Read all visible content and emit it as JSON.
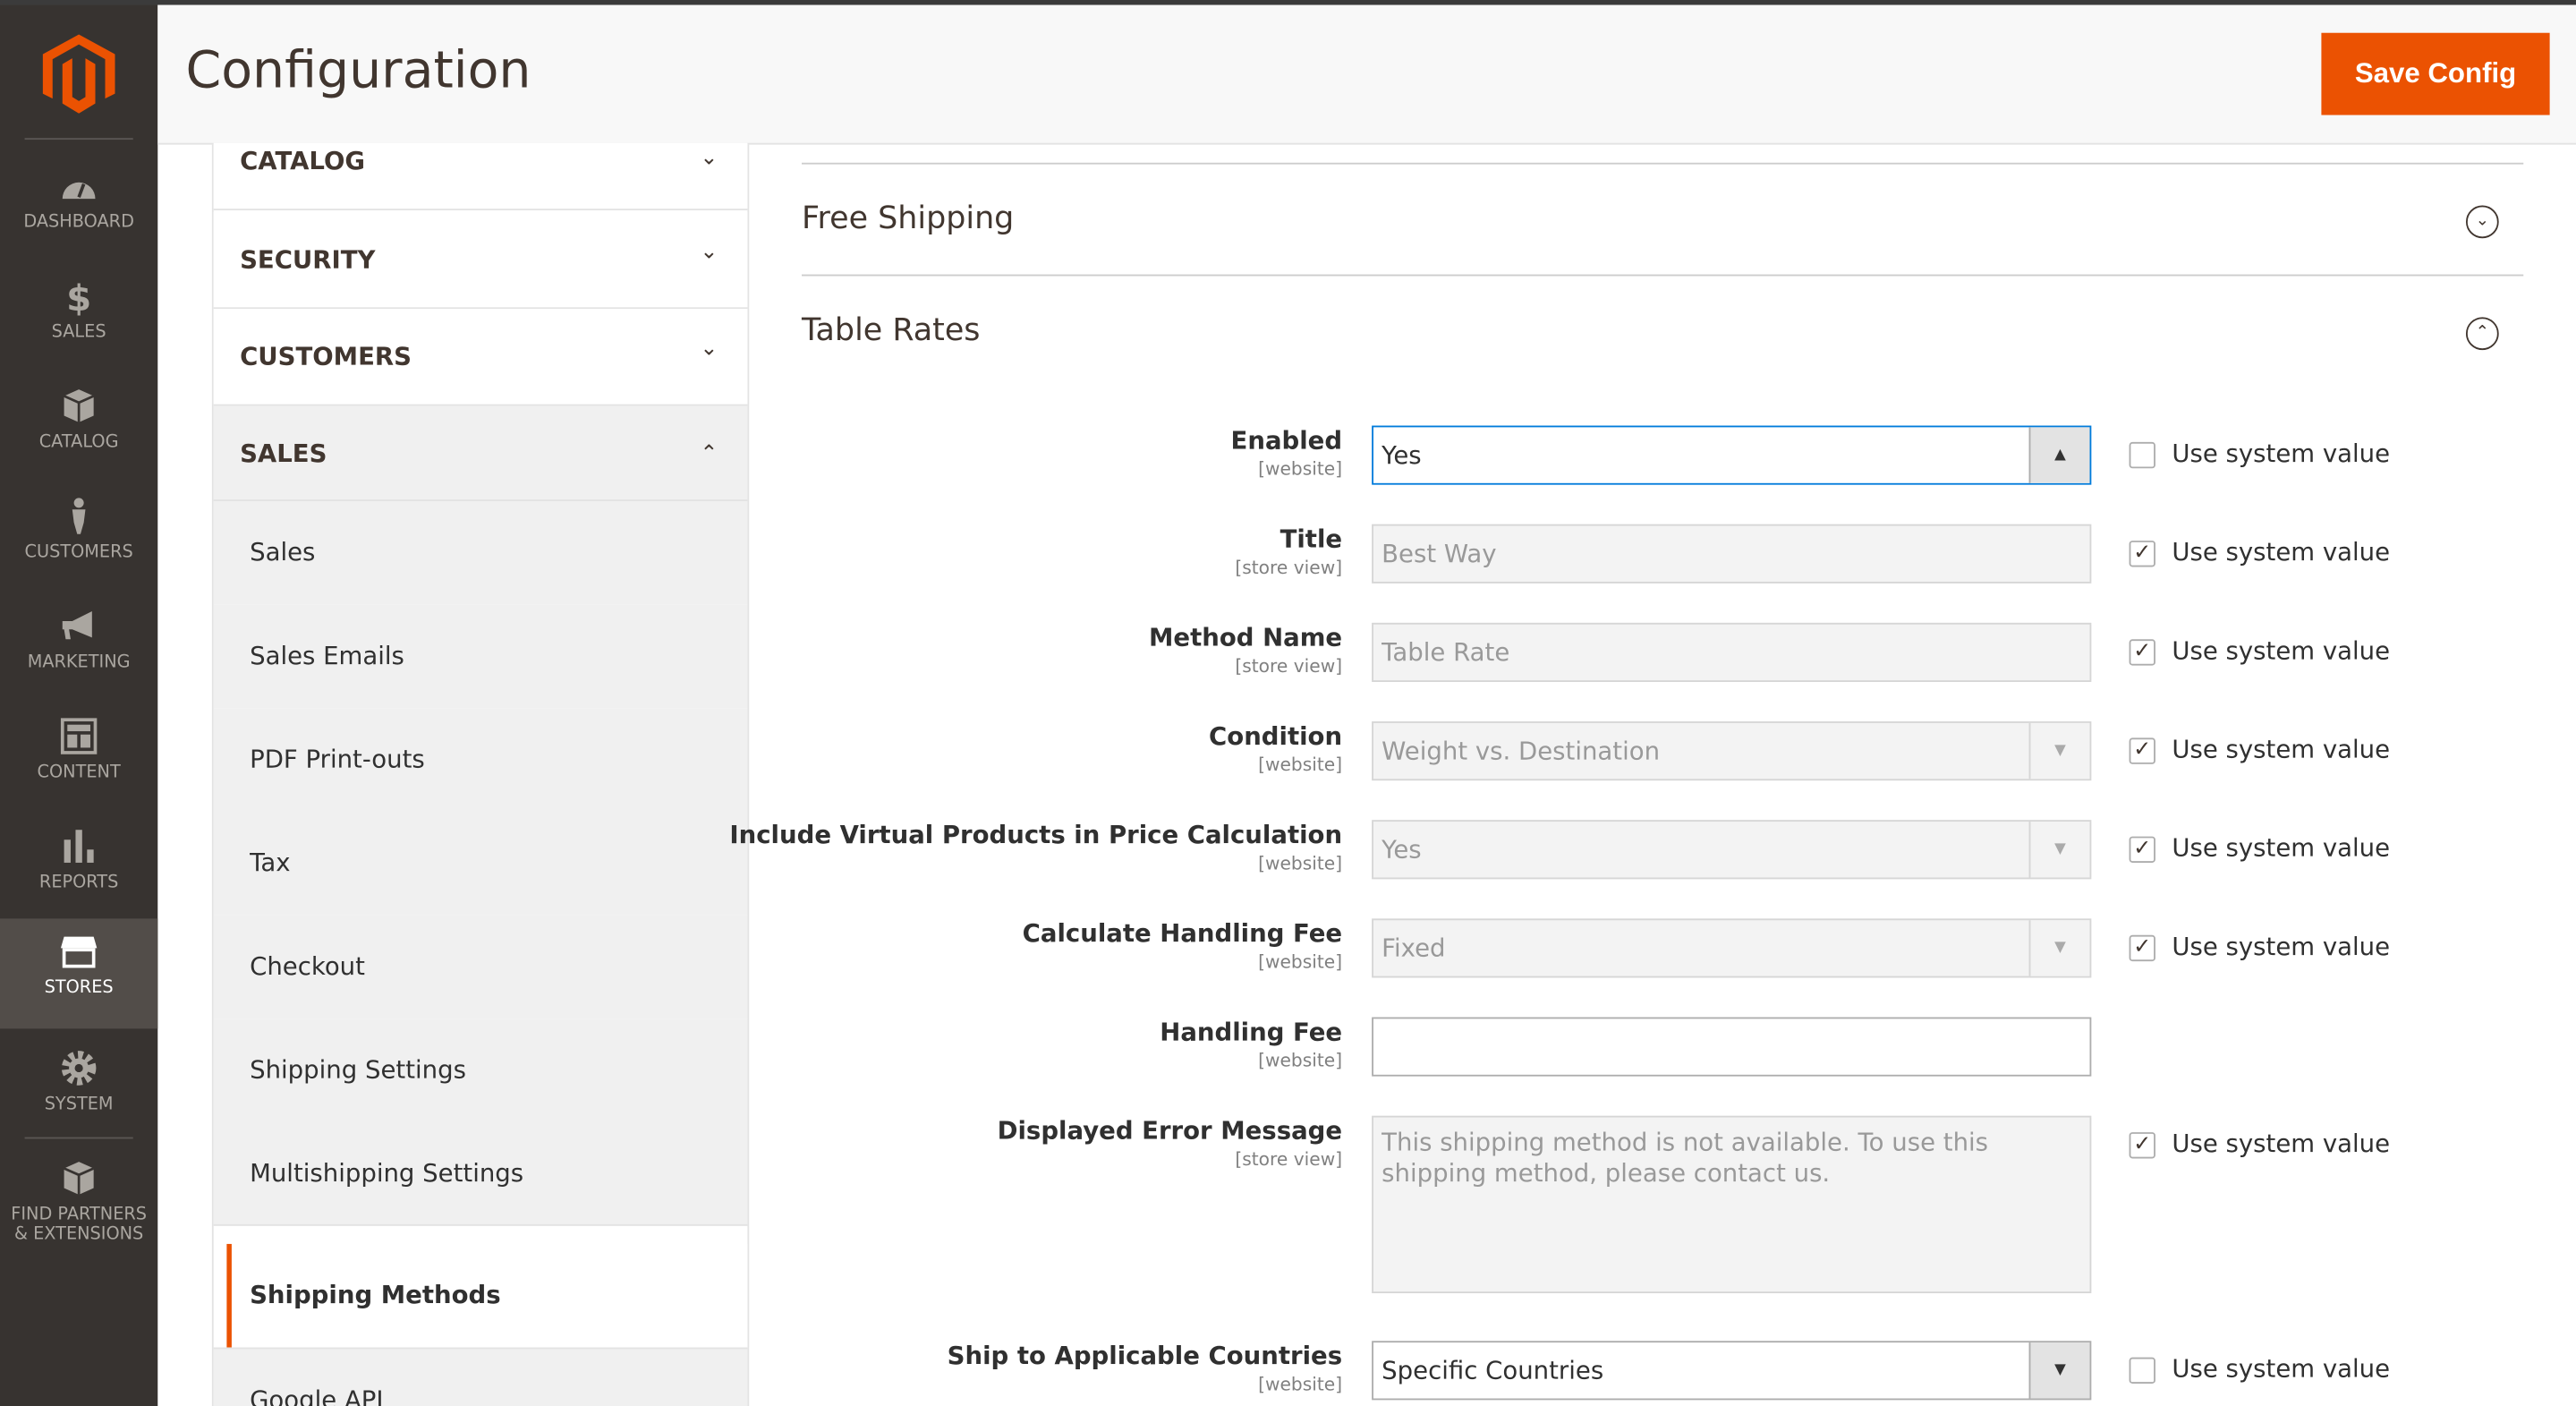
{
  "header": {
    "title": "Configuration",
    "save_label": "Save Config"
  },
  "nav": [
    {
      "label": "DASHBOARD",
      "icon": "dashboard-icon"
    },
    {
      "label": "SALES",
      "icon": "dollar-icon"
    },
    {
      "label": "CATALOG",
      "icon": "box-icon"
    },
    {
      "label": "CUSTOMERS",
      "icon": "person-icon"
    },
    {
      "label": "MARKETING",
      "icon": "megaphone-icon"
    },
    {
      "label": "CONTENT",
      "icon": "layout-icon"
    },
    {
      "label": "REPORTS",
      "icon": "bar-chart-icon"
    },
    {
      "label": "STORES",
      "icon": "store-icon"
    },
    {
      "label": "SYSTEM",
      "icon": "gear-icon"
    },
    {
      "label": "FIND PARTNERS",
      "label2": "& EXTENSIONS",
      "icon": "extensions-icon"
    }
  ],
  "config_tabs": [
    {
      "label": "CATALOG"
    },
    {
      "label": "SECURITY"
    },
    {
      "label": "CUSTOMERS"
    },
    {
      "label": "SALES"
    }
  ],
  "sales_items": [
    "Sales",
    "Sales Emails",
    "PDF Print-outs",
    "Tax",
    "Checkout",
    "Shipping Settings",
    "Multishipping Settings",
    "Shipping Methods",
    "Google API"
  ],
  "sections": {
    "free_shipping": "Free Shipping",
    "table_rates": "Table Rates"
  },
  "use_system_value": "Use system value",
  "fields": [
    {
      "label": "Enabled",
      "scope": "[website]",
      "value": "Yes",
      "system": false
    },
    {
      "label": "Title",
      "scope": "[store view]",
      "value": "Best Way",
      "system": true
    },
    {
      "label": "Method Name",
      "scope": "[store view]",
      "value": "Table Rate",
      "system": true
    },
    {
      "label": "Condition",
      "scope": "[website]",
      "value": "Weight vs. Destination",
      "system": true
    },
    {
      "label": "Include Virtual Products in Price Calculation",
      "scope": "[website]",
      "value": "Yes",
      "system": true
    },
    {
      "label": "Calculate Handling Fee",
      "scope": "[website]",
      "value": "Fixed",
      "system": true
    },
    {
      "label": "Handling Fee",
      "scope": "[website]",
      "value": ""
    },
    {
      "label": "Displayed Error Message",
      "scope": "[store view]",
      "value": "This shipping method is not available. To use this shipping method, please contact us.",
      "system": true
    },
    {
      "label": "Ship to Applicable Countries",
      "scope": "[website]",
      "value": "Specific Countries",
      "system": false
    }
  ]
}
